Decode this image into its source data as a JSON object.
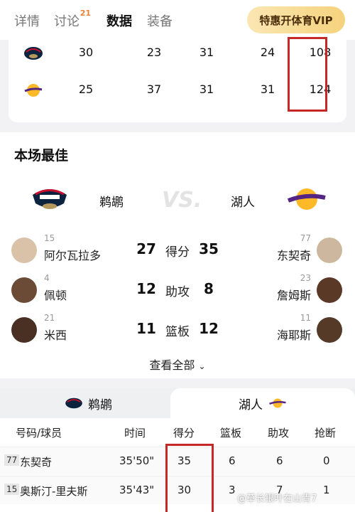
{
  "tabs": [
    {
      "label": "详情"
    },
    {
      "label": "讨论",
      "badge": "21"
    },
    {
      "label": "数据"
    },
    {
      "label": "装备"
    }
  ],
  "vip_button": "特惠开体育VIP",
  "quarter_scores": [
    {
      "team_logo": "pelicans-logo",
      "q": [
        "30",
        "23",
        "31",
        "24"
      ],
      "total": "108"
    },
    {
      "team_logo": "lakers-logo",
      "q": [
        "25",
        "37",
        "31",
        "31"
      ],
      "total": "124"
    }
  ],
  "best": {
    "title": "本场最佳",
    "home_name": "鹈鹕",
    "away_name": "湖人",
    "vs": "VS.",
    "rows": [
      {
        "home_num": "15",
        "home_name": "阿尔瓦拉多",
        "home_val": "27",
        "label": "得分",
        "away_val": "35",
        "away_num": "77",
        "away_name": "东契奇"
      },
      {
        "home_num": "4",
        "home_name": "佩顿",
        "home_val": "12",
        "label": "助攻",
        "away_val": "8",
        "away_num": "23",
        "away_name": "詹姆斯"
      },
      {
        "home_num": "21",
        "home_name": "米西",
        "home_val": "11",
        "label": "篮板",
        "away_val": "12",
        "away_num": "11",
        "away_name": "海耶斯"
      }
    ],
    "view_all": "查看全部"
  },
  "team_tabs": {
    "home": "鹈鹕",
    "away": "湖人"
  },
  "table": {
    "headers": [
      "号码/球员",
      "时间",
      "得分",
      "篮板",
      "助攻",
      "抢断"
    ],
    "rows": [
      {
        "num": "77",
        "name": "东契奇",
        "time": "35'50\"",
        "pts": "35",
        "reb": "6",
        "ast": "6",
        "stl": "0"
      },
      {
        "num": "15",
        "name": "奥斯汀-里夫斯",
        "time": "35'43\"",
        "pts": "30",
        "reb": "3",
        "ast": "7",
        "stl": "1"
      }
    ]
  },
  "watermark": "@草长银叶在山青7",
  "colors": {
    "highlight": "#c62828",
    "badge": "#e8823a",
    "vip_gold": "#f5d27c"
  }
}
